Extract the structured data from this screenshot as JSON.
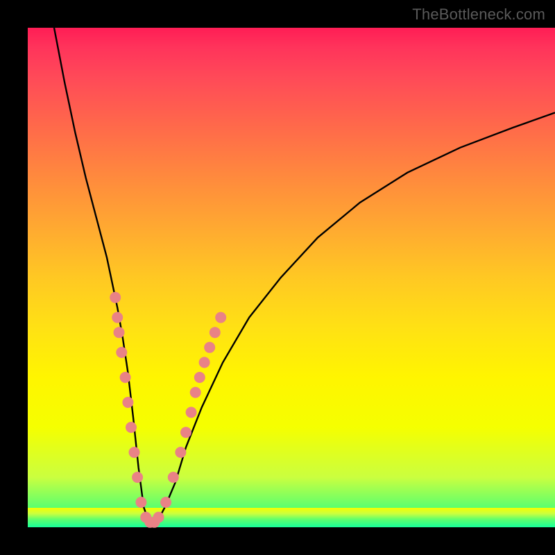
{
  "watermark": "TheBottleneck.com",
  "colors": {
    "gradient_top": "#ff1d55",
    "gradient_mid": "#ffe114",
    "gradient_bottom": "#16ff9a",
    "curve": "#000000",
    "dot": "#e98286",
    "frame": "#000000"
  },
  "chart_data": {
    "type": "line",
    "title": "",
    "xlabel": "",
    "ylabel": "",
    "xlim": [
      0,
      100
    ],
    "ylim": [
      0,
      100
    ],
    "grid": false,
    "legend": false,
    "series": [
      {
        "name": "bottleneck-curve",
        "x": [
          5,
          7,
          9,
          11,
          13,
          15,
          17,
          18,
          19,
          20,
          21,
          22,
          23,
          24,
          25,
          26,
          28,
          30,
          33,
          37,
          42,
          48,
          55,
          63,
          72,
          82,
          92,
          100
        ],
        "y": [
          100,
          89,
          79,
          70,
          62,
          54,
          44,
          38,
          31,
          22,
          12,
          4,
          1,
          1,
          2,
          4,
          9,
          16,
          24,
          33,
          42,
          50,
          58,
          65,
          71,
          76,
          80,
          83
        ]
      }
    ],
    "dots": [
      {
        "x": 16.6,
        "y": 46
      },
      {
        "x": 17.0,
        "y": 42
      },
      {
        "x": 17.3,
        "y": 39
      },
      {
        "x": 17.8,
        "y": 35
      },
      {
        "x": 18.5,
        "y": 30
      },
      {
        "x": 19.0,
        "y": 25
      },
      {
        "x": 19.6,
        "y": 20
      },
      {
        "x": 20.2,
        "y": 15
      },
      {
        "x": 20.8,
        "y": 10
      },
      {
        "x": 21.5,
        "y": 5
      },
      {
        "x": 22.4,
        "y": 2
      },
      {
        "x": 23.2,
        "y": 1
      },
      {
        "x": 24.0,
        "y": 1
      },
      {
        "x": 24.8,
        "y": 2
      },
      {
        "x": 26.2,
        "y": 5
      },
      {
        "x": 27.6,
        "y": 10
      },
      {
        "x": 29.0,
        "y": 15
      },
      {
        "x": 30.0,
        "y": 19
      },
      {
        "x": 31.0,
        "y": 23
      },
      {
        "x": 31.8,
        "y": 27
      },
      {
        "x": 32.6,
        "y": 30
      },
      {
        "x": 33.5,
        "y": 33
      },
      {
        "x": 34.5,
        "y": 36
      },
      {
        "x": 35.5,
        "y": 39
      },
      {
        "x": 36.6,
        "y": 42
      }
    ]
  }
}
